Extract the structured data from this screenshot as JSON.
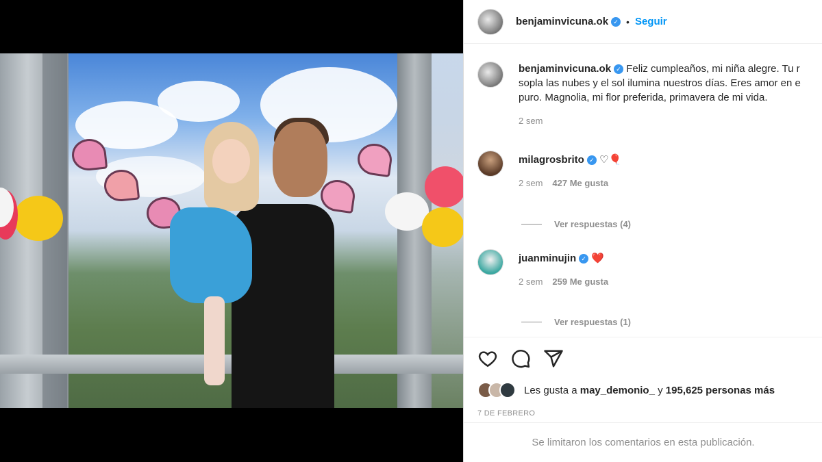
{
  "post": {
    "author": "benjaminvicuna.ok",
    "follow_label": "Seguir",
    "dot": "•"
  },
  "caption": {
    "author": "benjaminvicuna.ok",
    "line1": "Feliz cumpleaños, mi niña alegre. Tu r",
    "line2": "sopla las nubes y el sol ilumina nuestros días. Eres amor en e",
    "line3": "puro. Magnolia, mi flor preferida, primavera de mi vida.",
    "time": "2 sem"
  },
  "comments": [
    {
      "author": "milagrosbrito",
      "text": "♡🎈",
      "time": "2 sem",
      "likes": "427 Me gusta",
      "replies": "Ver respuestas (4)"
    },
    {
      "author": "juanminujin",
      "text": "❤️",
      "time": "2 sem",
      "likes": "259 Me gusta",
      "replies": "Ver respuestas (1)"
    }
  ],
  "likes": {
    "prefix": "Les gusta a",
    "user": "may_demonio_",
    "middle": "y",
    "count": "195,625 personas más"
  },
  "date": "7 DE FEBRERO",
  "footer": "Se limitaron los comentarios en esta publicación.",
  "icons": [
    "heart-icon",
    "comment-icon",
    "share-icon"
  ],
  "colors": {
    "accent": "#0095f6",
    "verified": "#3897f0",
    "secondary": "#8e8e8e"
  }
}
